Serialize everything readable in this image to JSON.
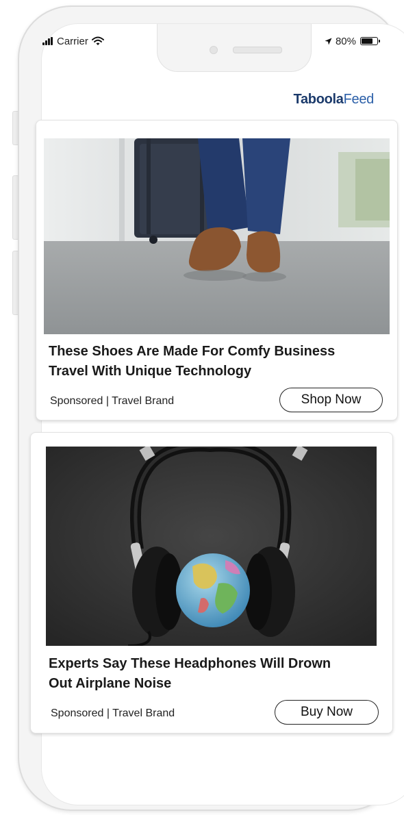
{
  "status_bar": {
    "carrier": "Carrier",
    "battery_text": "80%",
    "battery_level": 0.8
  },
  "brand": {
    "name_bold": "Taboola",
    "name_light": "Feed"
  },
  "cards": [
    {
      "title": "These Shoes Are Made For Comfy Business Travel With Unique Technology",
      "title_line1": "These Shoes Are Made For Comfy Business",
      "title_line2": "Travel With Unique Technology",
      "meta": "Sponsored | Travel Brand",
      "cta_label": "Shop Now"
    },
    {
      "title": "Experts Say These Headphones Will Drown Out Airplane Noise",
      "title_line1": "Experts Say These Headphones Will Drown",
      "title_line2": "Out Airplane Noise",
      "meta": "Sponsored | Travel Brand",
      "cta_label": "Buy Now"
    }
  ],
  "colors": {
    "brand_dark": "#1b3a6b",
    "brand_light": "#2b5fa8",
    "text": "#1a1a1a",
    "page_bg": "#ffffff"
  }
}
